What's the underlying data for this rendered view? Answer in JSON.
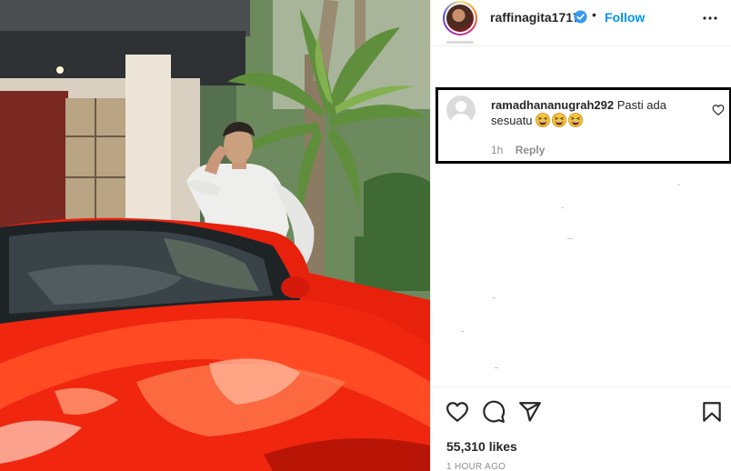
{
  "post": {
    "username": "raffinagita1717",
    "verified": true,
    "separator": "•",
    "follow_label": "Follow",
    "more_icon": "more-horizontal-icon",
    "likes": "55,310 likes",
    "time": "1 HOUR AGO"
  },
  "comment": {
    "username": "ramadhananugrah292",
    "text": "Pasti ada sesuatu",
    "emojis": [
      "grinning-squinting-face",
      "grinning-squinting-face",
      "grinning-squinting-face"
    ],
    "time": "1h",
    "reply_label": "Reply"
  },
  "actions": [
    "heart-icon",
    "comment-icon",
    "share-icon",
    "bookmark-icon"
  ],
  "colors": {
    "link": "#0095f6",
    "text": "#262626",
    "muted": "#8e8e8e",
    "highlight_border": "#000000",
    "car_red": "#e8210d"
  }
}
